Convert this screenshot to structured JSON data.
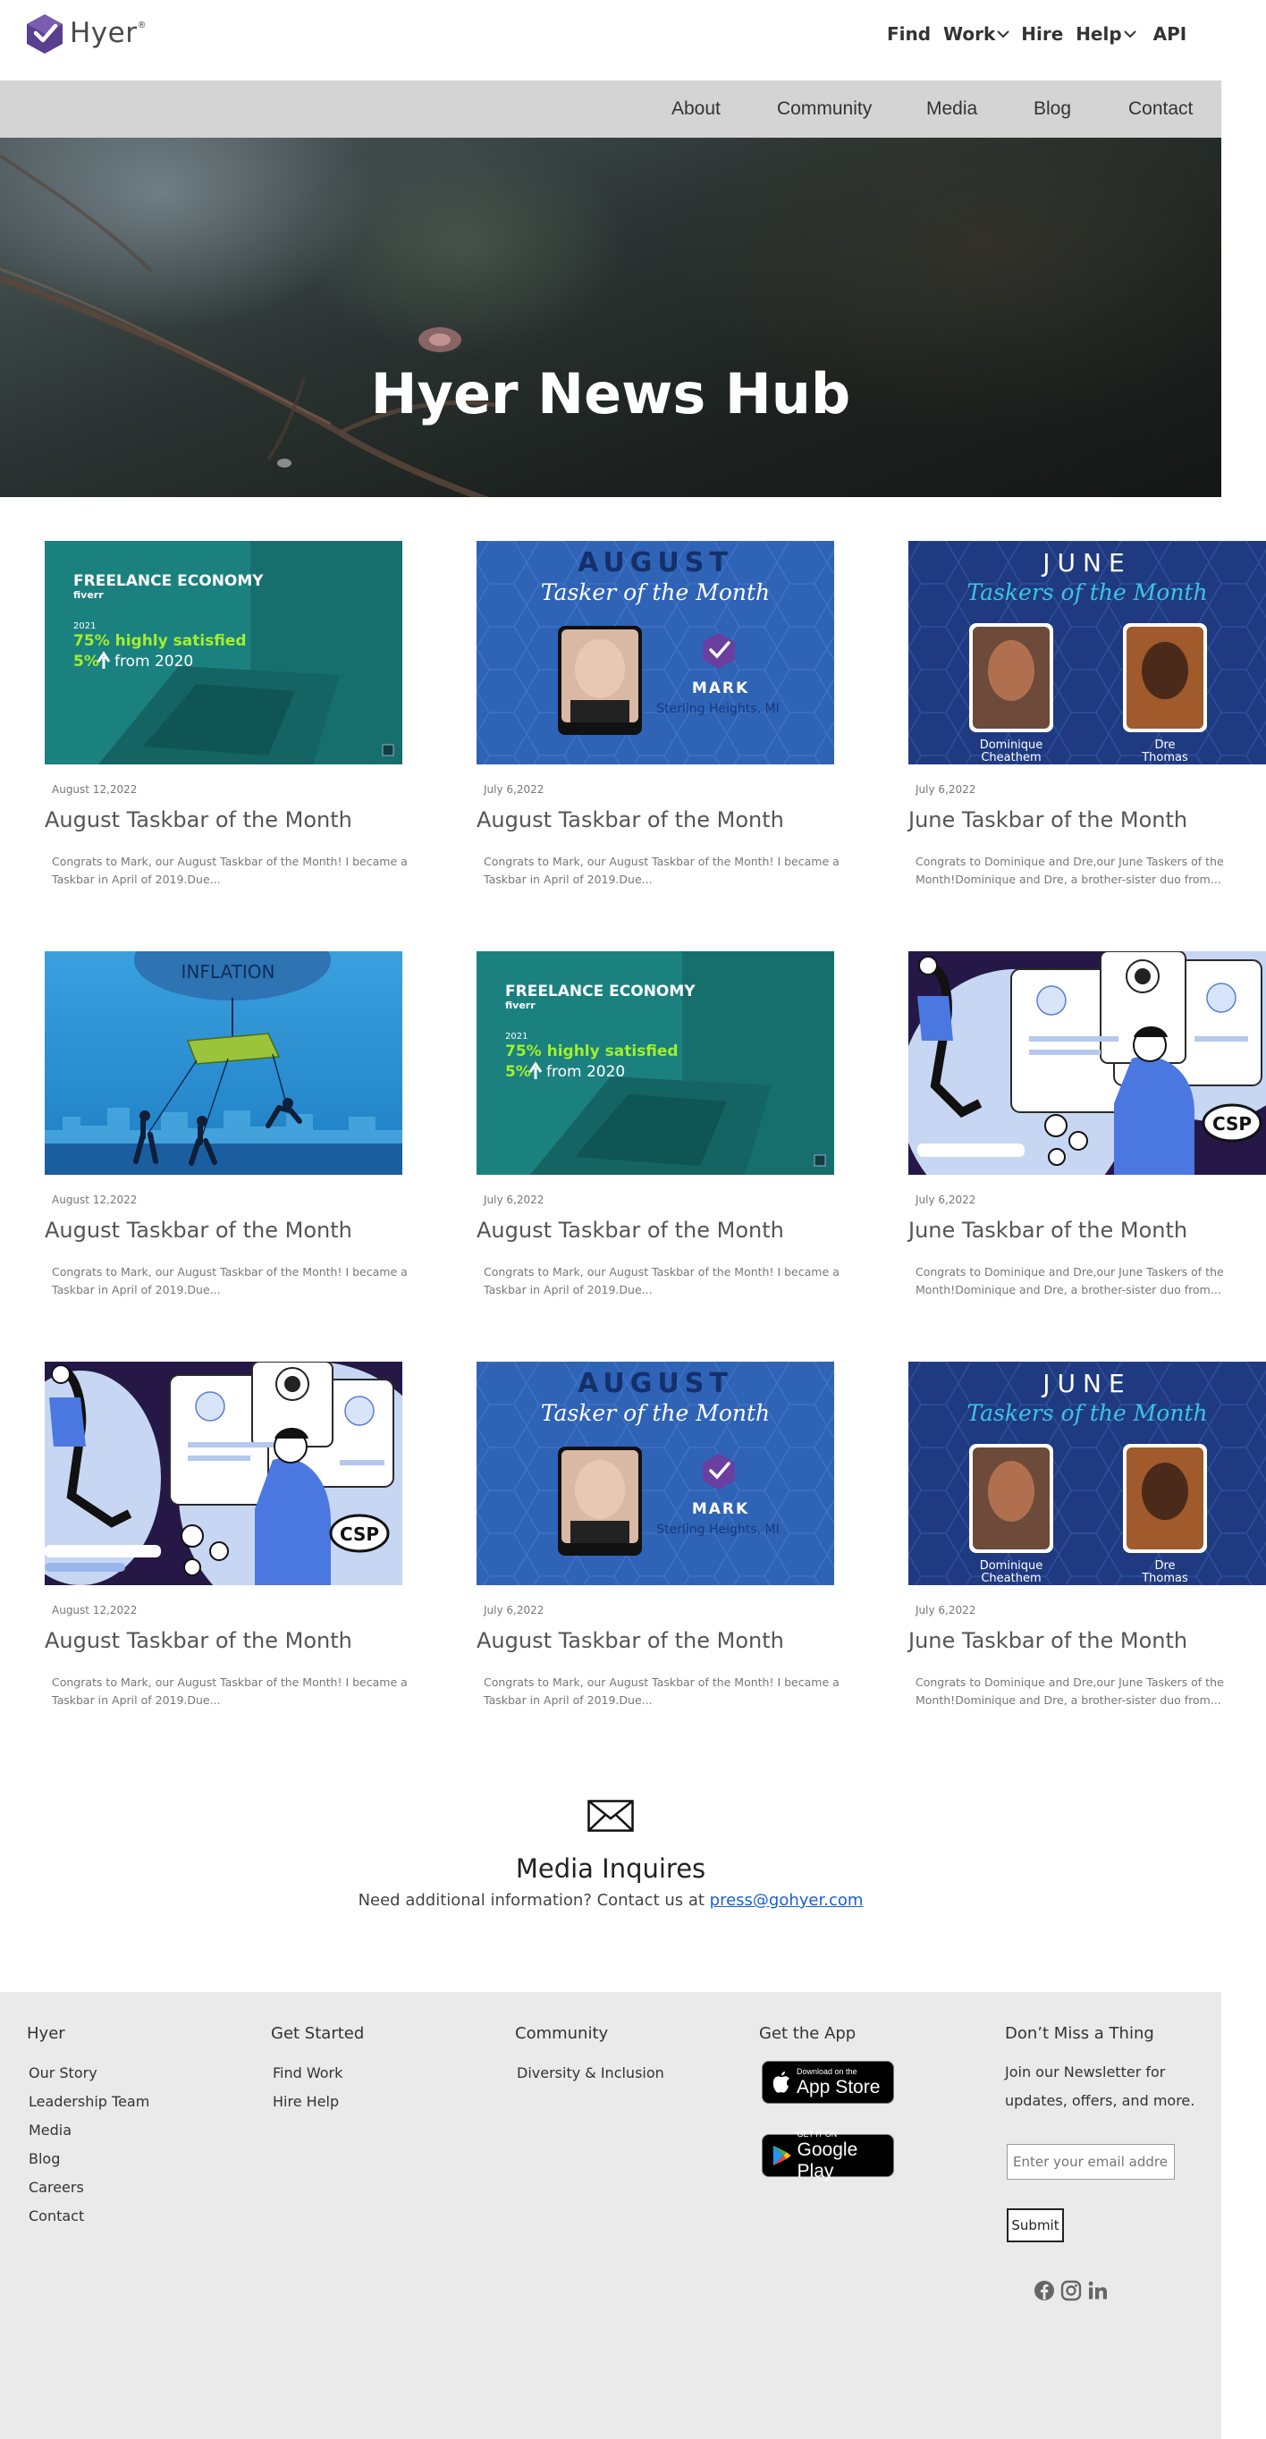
{
  "header": {
    "brand": "Hyer",
    "brand_mark": "®",
    "nav": [
      {
        "label": "Find  Work",
        "has_dropdown": true
      },
      {
        "label": "Hire  Help",
        "has_dropdown": true
      },
      {
        "label": "API",
        "has_dropdown": false
      }
    ]
  },
  "subnav": [
    "About",
    "Community",
    "Media",
    "Blog",
    "Contact"
  ],
  "hero": {
    "title": "Hyer News Hub"
  },
  "thumb_text": {
    "freelance_title": "FREELANCE ECONOMY",
    "freelance_brand": "fiverr",
    "freelance_year": "2021",
    "freelance_stat1": "75% highly satisfied",
    "freelance_stat2_num": "5%",
    "freelance_stat2_rest": "from 2020",
    "august": "AUGUST",
    "tasker_script": "Tasker of the Month",
    "mark_name": "MARK",
    "mark_location": "Sterling Heights, MI",
    "june": "JUNE",
    "taskers_script": "Taskers of the Month",
    "june_person1_a": "Dominique",
    "june_person1_b": "Cheathem",
    "june_person2_a": "Dre",
    "june_person2_b": "Thomas",
    "inflation": "INFLATION",
    "csp": "CSP"
  },
  "posts": [
    {
      "date": "August 12,2022",
      "title": "August Taskbar of the Month",
      "excerpt": "Congrats to Mark, our August Taskbar of the Month! I became a Taskbar in April of 2019.Due...",
      "image": "freelance-economy"
    },
    {
      "date": "July 6,2022",
      "title": "August Taskbar of the Month",
      "excerpt": "Congrats to Mark, our August Taskbar of the Month! I became a Taskbar in April of 2019.Due...",
      "image": "august-tasker"
    },
    {
      "date": "July 6,2022",
      "title": "June Taskbar of the Month",
      "excerpt": "Congrats to Dominique and Dre,our June Taskers of the Month!Dominique and Dre, a brother-sister duo from...",
      "image": "june-taskers"
    },
    {
      "date": "August 12,2022",
      "title": "August Taskbar of the Month",
      "excerpt": "Congrats to Mark, our August Taskbar of the Month! I became a Taskbar in April of 2019.Due...",
      "image": "inflation"
    },
    {
      "date": "July 6,2022",
      "title": "August Taskbar of the Month",
      "excerpt": "Congrats to Mark, our August Taskbar of the Month! I became a Taskbar in April of 2019.Due...",
      "image": "freelance-economy"
    },
    {
      "date": "July 6,2022",
      "title": "June Taskbar of the Month",
      "excerpt": "Congrats to Dominique and Dre,our June Taskers of the Month!Dominique and Dre, a brother-sister duo from...",
      "image": "csp-illustration"
    },
    {
      "date": "August 12,2022",
      "title": "August Taskbar of the Month",
      "excerpt": "Congrats to Mark, our August Taskbar of the Month! I became a Taskbar in April of 2019.Due...",
      "image": "csp-illustration"
    },
    {
      "date": "July 6,2022",
      "title": "August Taskbar of the Month",
      "excerpt": "Congrats to Mark, our August Taskbar of the Month! I became a Taskbar in April of 2019.Due...",
      "image": "august-tasker"
    },
    {
      "date": "July 6,2022",
      "title": "June Taskbar of the Month",
      "excerpt": "Congrats to Dominique and Dre,our June Taskers of the Month!Dominique and Dre, a brother-sister duo from...",
      "image": "june-taskers"
    }
  ],
  "media": {
    "icon": "envelope-icon",
    "title": "Media Inquires",
    "text": "Need additional information? Contact us at ",
    "email": "press@gohyer.com"
  },
  "footer": {
    "hyer": {
      "title": "Hyer",
      "links": [
        "Our Story",
        "Leadership Team",
        "Media",
        "Blog",
        "Careers",
        "Contact"
      ]
    },
    "get_started": {
      "title": "Get Started",
      "links": [
        "Find Work",
        "Hire Help"
      ]
    },
    "community": {
      "title": "Community",
      "links": [
        "Diversity & Inclusion"
      ]
    },
    "get_app": {
      "title": "Get the App",
      "app_store_small": "Download on the",
      "app_store_big": "App Store",
      "google_small": "GET IT ON",
      "google_big": "Google Play"
    },
    "newsletter": {
      "title": "Don’t Miss a Thing",
      "text": "Join our Newsletter for updates, offers, and more.",
      "placeholder": "Enter your email address",
      "submit": "Submit"
    },
    "social_icons": [
      "facebook-icon",
      "instagram-icon",
      "linkedin-icon"
    ]
  },
  "colors": {
    "accent_purple": "#5b3e8f",
    "link_blue": "#1a5fd6",
    "subnav_bg": "#d4d4d4",
    "footer_bg": "#ebeaea",
    "thumb_teal": "#1b8a86",
    "thumb_blue": "#2d5fb0",
    "thumb_navy": "#1f3a80",
    "lime": "#a4ef2c"
  }
}
